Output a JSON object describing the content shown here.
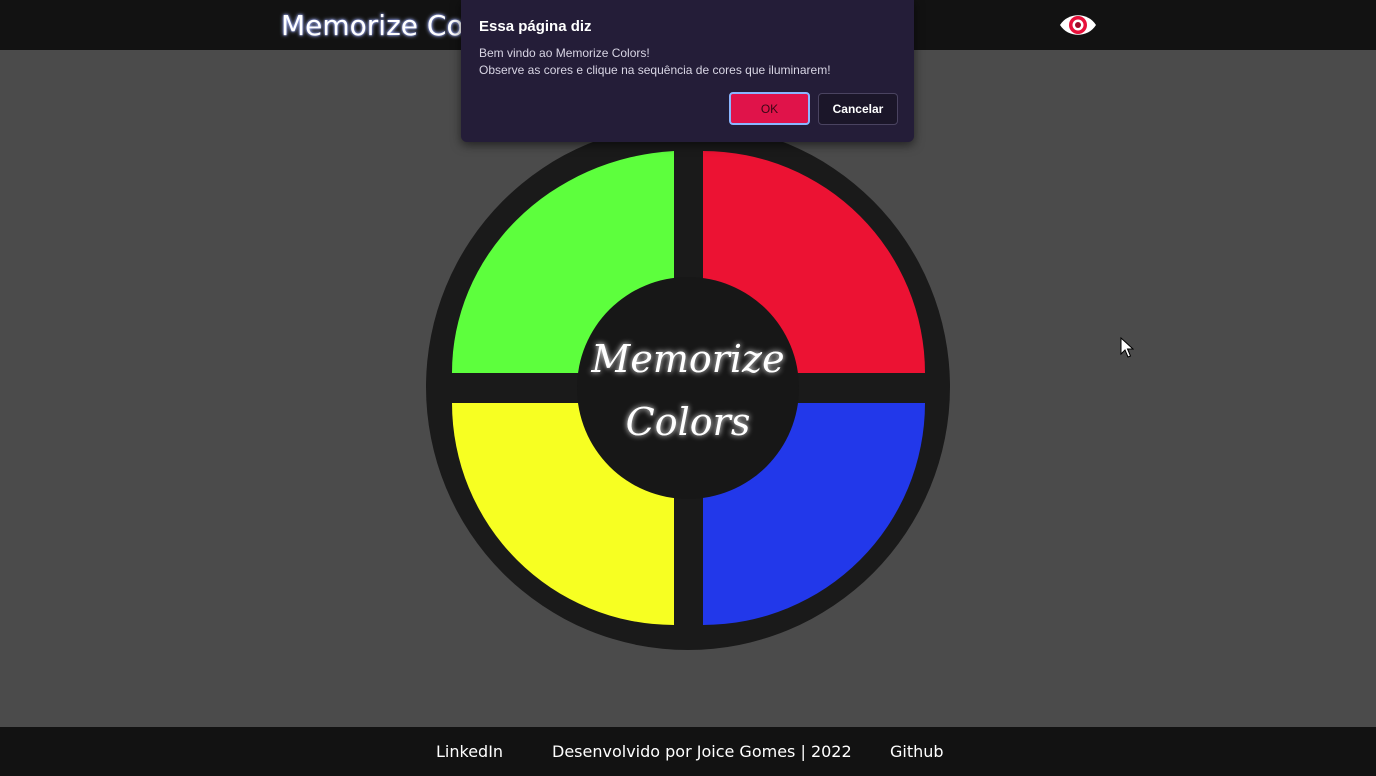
{
  "header": {
    "title": "Memorize Colors",
    "eye_icon": "eye-icon"
  },
  "board": {
    "center_text_line1": "Memorize",
    "center_text_line2": "Colors",
    "pads": [
      {
        "name": "green",
        "color": "#5dff3d"
      },
      {
        "name": "red",
        "color": "#ec1233"
      },
      {
        "name": "yellow",
        "color": "#f7ff22"
      },
      {
        "name": "blue",
        "color": "#2238ea"
      }
    ],
    "ring_color": "#1a1a1a"
  },
  "dialog": {
    "title": "Essa página diz",
    "message_line1": "Bem vindo ao Memorize Colors!",
    "message_line2": "Observe as cores e clique na sequência de cores que iluminarem!",
    "ok_label": "OK",
    "cancel_label": "Cancelar"
  },
  "footer": {
    "linkedin_label": "LinkedIn",
    "credit": "Desenvolvido por Joice Gomes | 2022",
    "github_label": "Github"
  },
  "colors": {
    "page_background": "#4b4b4b",
    "bar_background": "#121212",
    "dialog_background": "#241d38",
    "ok_button": "#e0134a"
  }
}
